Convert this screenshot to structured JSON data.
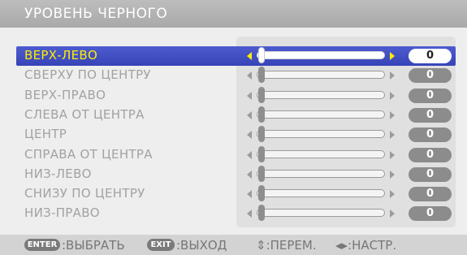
{
  "title": "УРОВЕНЬ ЧЕРНОГО",
  "rows": [
    {
      "label": "ВЕРХ-ЛЕВО",
      "value": "0",
      "position": 0,
      "selected": true
    },
    {
      "label": "СВЕРХУ ПО ЦЕНТРУ",
      "value": "0",
      "position": 0,
      "selected": false
    },
    {
      "label": "ВЕРХ-ПРАВО",
      "value": "0",
      "position": 0,
      "selected": false
    },
    {
      "label": "СЛЕВА ОТ ЦЕНТРА",
      "value": "0",
      "position": 0,
      "selected": false
    },
    {
      "label": "ЦЕНТР",
      "value": "0",
      "position": 0,
      "selected": false
    },
    {
      "label": "СПРАВА ОТ ЦЕНТРА",
      "value": "0",
      "position": 0,
      "selected": false
    },
    {
      "label": "НИЗ-ЛЕВО",
      "value": "0",
      "position": 0,
      "selected": false
    },
    {
      "label": "СНИЗУ ПО ЦЕНТРУ",
      "value": "0",
      "position": 0,
      "selected": false
    },
    {
      "label": "НИЗ-ПРАВО",
      "value": "0",
      "position": 0,
      "selected": false
    }
  ],
  "footer": {
    "enter_key": "ENTER",
    "enter_label": ":ВЫБРАТЬ",
    "exit_key": "EXIT",
    "exit_label": ":ВЫХОД",
    "move_label": "⇕:ПЕРЕМ.",
    "adjust_label": "◂▸:НАСТР."
  },
  "colors": {
    "highlight": "#3f4dc4",
    "selected_text": "#ffee00",
    "inactive_text": "#a2a2a2"
  }
}
